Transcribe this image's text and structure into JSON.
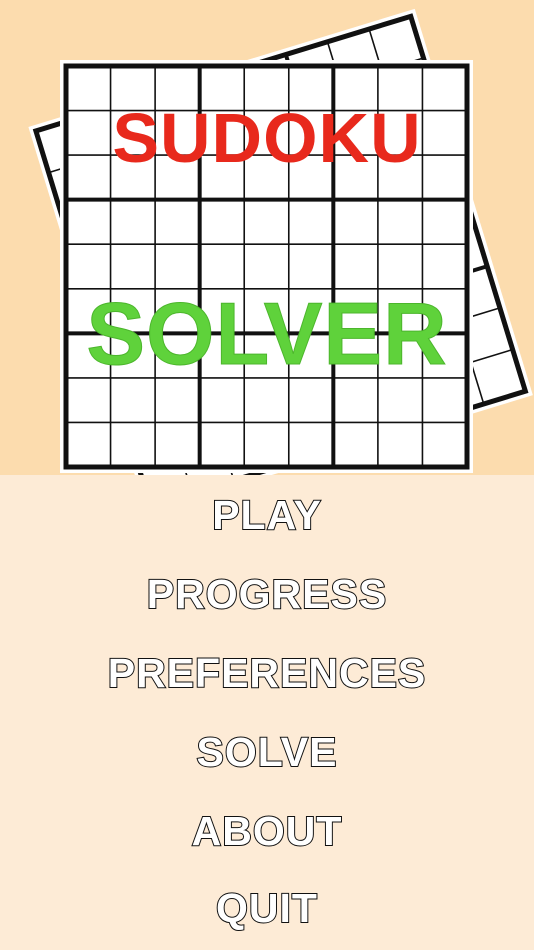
{
  "app": {
    "title_line1": "SUDOKU",
    "title_line2": "SOLVER",
    "colors": {
      "banner_bg": "#fcdcae",
      "menu_bg": "#fdebd6",
      "title_line1": "#e8291c",
      "title_line2": "#5fd23b",
      "grid_line": "#111111"
    }
  },
  "menu": {
    "items": [
      {
        "label": "PLAY"
      },
      {
        "label": "PROGRESS"
      },
      {
        "label": "PREFERENCES"
      },
      {
        "label": "SOLVE"
      },
      {
        "label": "ABOUT"
      },
      {
        "label": "QUIT"
      }
    ]
  }
}
